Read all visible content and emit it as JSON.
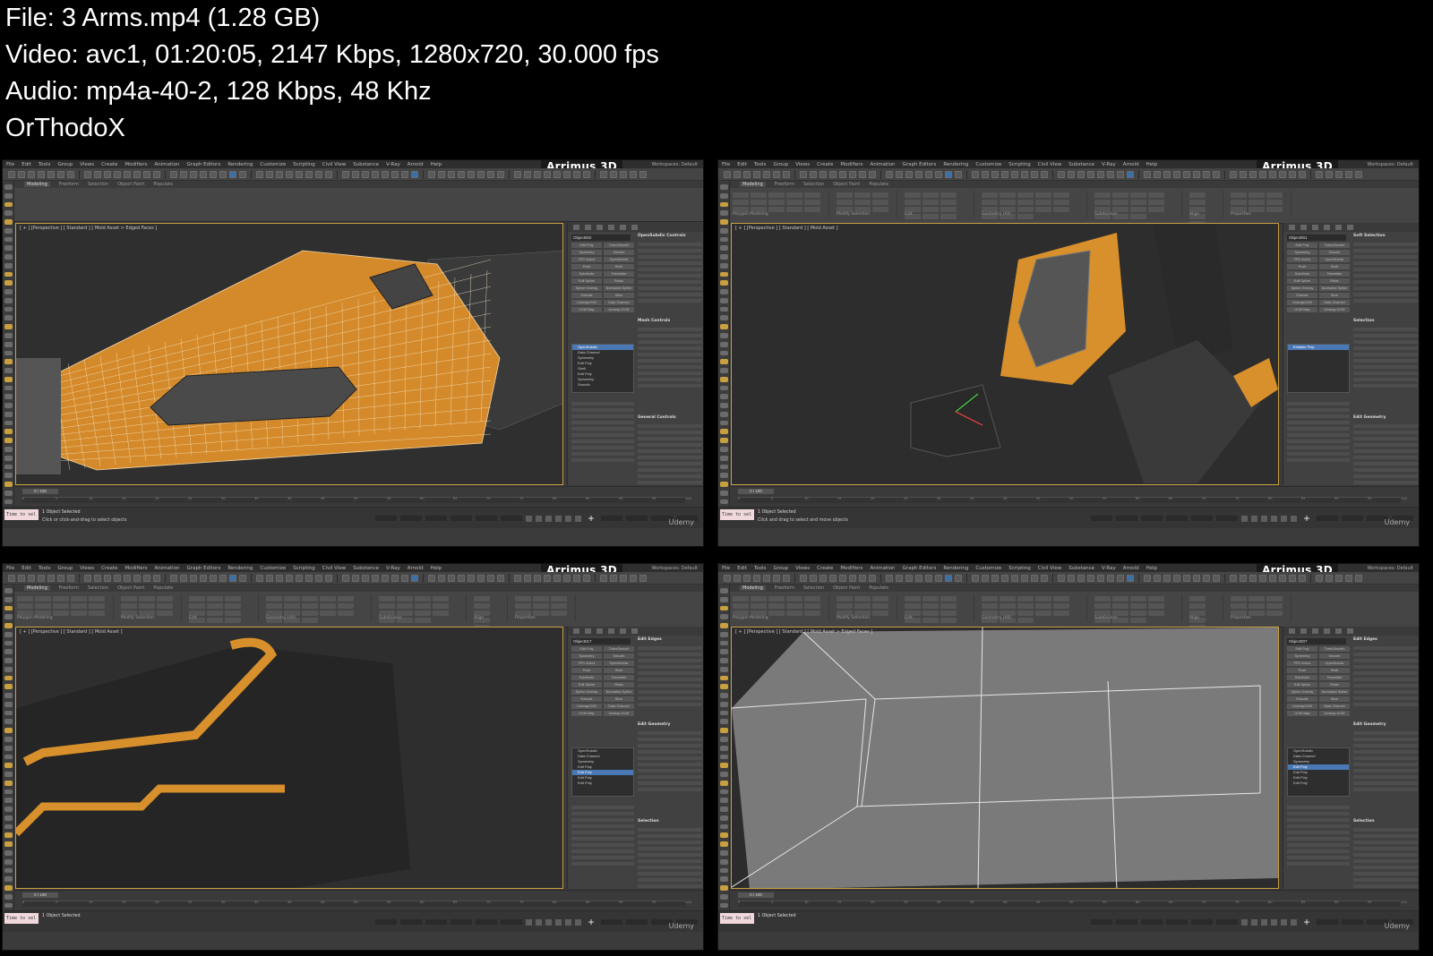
{
  "info": {
    "file": "File: 3  Arms.mp4 (1.28 GB)",
    "video": "Video: avc1, 01:20:05, 2147 Kbps, 1280x720, 30.000 fps",
    "audio": "Audio: mp4a-40-2, 128 Kbps, 48 Khz",
    "author": "OrThodoX"
  },
  "app": {
    "brand": "Arrimus 3D",
    "workspace": "Workspaces: Default",
    "menus": [
      "File",
      "Edit",
      "Tools",
      "Group",
      "Views",
      "Create",
      "Modifiers",
      "Animation",
      "Graph Editors",
      "Rendering",
      "Customize",
      "Scripting",
      "Civil View",
      "Substance",
      "V-Ray",
      "Arnold",
      "Help"
    ],
    "ribbon_tabs": [
      "Modeling",
      "Freeform",
      "Selection",
      "Object Paint",
      "Populate"
    ],
    "ribbon_groups": [
      "Polygon Modeling",
      "Modify Selection",
      "Edit",
      "Geometry (All)",
      "Subdivision",
      "Align",
      "Properties"
    ],
    "watermark": "Udemy"
  },
  "frames": [
    {
      "viewport_label": "[ + ] [Perspective ] [ Standard ] [ Mold Asset > Edged Faces ]",
      "object_name": "Object002",
      "rollouts": [
        "OpenSubdiv Controls",
        "Mesh Controls",
        "General Controls"
      ],
      "stack": [
        "OpenSubdiv",
        "Data Channel",
        "Symmetry",
        "Edit Poly",
        "Shell",
        "Edit Poly",
        "Symmetry",
        "Smooth"
      ],
      "stack_selected": 0,
      "frame_counter": "0 / 100",
      "script": "Time to sel",
      "status": "1 Object Selected",
      "prompt": "Click or click-and-drag to select objects"
    },
    {
      "viewport_label": "[ + ] [Perspective ] [ Standard ] [ Mold Asset ]",
      "object_name": "Object001",
      "rollouts": [
        "Soft Selection",
        "Selection",
        "Edit Geometry"
      ],
      "stack": [
        "Editable Poly"
      ],
      "stack_selected": 0,
      "frame_counter": "0 / 100",
      "script": "Time to sel",
      "status": "1 Object Selected",
      "prompt": "Click and drag to select and move objects"
    },
    {
      "viewport_label": "[ + ] [Perspective ] [ Standard ] [ Mold Asset ]",
      "object_name": "Object017",
      "rollouts": [
        "Edit Edges",
        "Edit Geometry",
        "Selection"
      ],
      "stack": [
        "OpenSubdiv",
        "Data Channel",
        "Symmetry",
        "Edit Poly",
        "Edit Poly",
        "Edit Poly",
        "Edit Poly"
      ],
      "stack_selected": 4,
      "frame_counter": "0 / 100",
      "script": "Time to sel",
      "status": "1 Object Selected",
      "prompt": ""
    },
    {
      "viewport_label": "[ + ] [Perspective ] [ Standard ] [ Mold Asset > Edged Faces ]",
      "object_name": "Object007",
      "rollouts": [
        "Edit Edges",
        "Edit Geometry",
        "Selection"
      ],
      "stack": [
        "OpenSubdiv",
        "Data Channel",
        "Symmetry",
        "Edit Poly",
        "Edit Poly",
        "Edit Poly",
        "Edit Poly"
      ],
      "stack_selected": 3,
      "frame_counter": "0 / 100",
      "script": "Time to sel",
      "status": "1 Object Selected",
      "prompt": ""
    }
  ],
  "modifier_buttons": [
    "Edit Poly",
    "TurboSmooth",
    "Symmetry",
    "Smooth",
    "FFD 4x4x4",
    "OpenSubdiv",
    "Push",
    "Shell",
    "Subdivide",
    "Tessellate",
    "Edit Spline",
    "Relax",
    "Spline Overlay",
    "Normalize Spline",
    "Extrude",
    "Slice",
    "UnwrapUVW",
    "Data Channel",
    "UVW Map",
    "Unwrap UVW"
  ],
  "timeline_ticks": [
    "0",
    "5",
    "10",
    "15",
    "20",
    "25",
    "30",
    "35",
    "40",
    "45",
    "50",
    "55",
    "60",
    "65",
    "70",
    "75",
    "80",
    "85",
    "90",
    "95",
    "100"
  ],
  "colors": {
    "accent": "#c9a043",
    "orange": "#d8902c",
    "selection": "#4a78b4"
  }
}
